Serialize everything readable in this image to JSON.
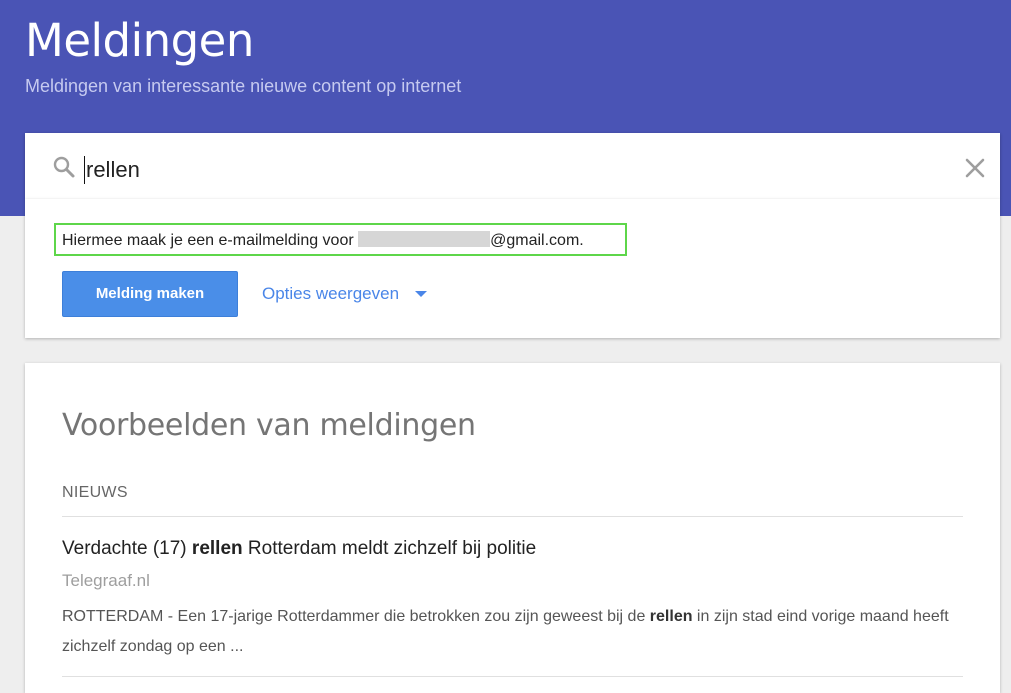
{
  "header": {
    "title": "Meldingen",
    "subtitle": "Meldingen van interessante nieuwe content op internet",
    "background_color": "#4a54b5"
  },
  "search": {
    "icon": "search-icon",
    "value": "rellen",
    "clear_icon": "close-icon"
  },
  "notice": {
    "text_before": "Hiermee maak je een e-mailmelding voor ",
    "text_after": "@gmail.com.",
    "highlight_color": "#5ed64a"
  },
  "actions": {
    "create_label": "Melding maken",
    "options_label": "Opties weergeven",
    "options_icon": "caret-down-icon",
    "accent_color": "#4a86e8"
  },
  "examples": {
    "title": "Voorbeelden van meldingen",
    "section_label": "NIEUWS",
    "items": [
      {
        "title_before": "Verdachte (17) ",
        "title_highlight": "rellen",
        "title_after": " Rotterdam meldt zichzelf bij politie",
        "source": "Telegraaf.nl",
        "snippet_before": "ROTTERDAM - Een 17-jarige Rotterdammer die betrokken zou zijn geweest bij de ",
        "snippet_highlight": "rellen",
        "snippet_after": " in zijn stad eind vorige maand heeft zichzelf zondag op een ..."
      }
    ]
  }
}
